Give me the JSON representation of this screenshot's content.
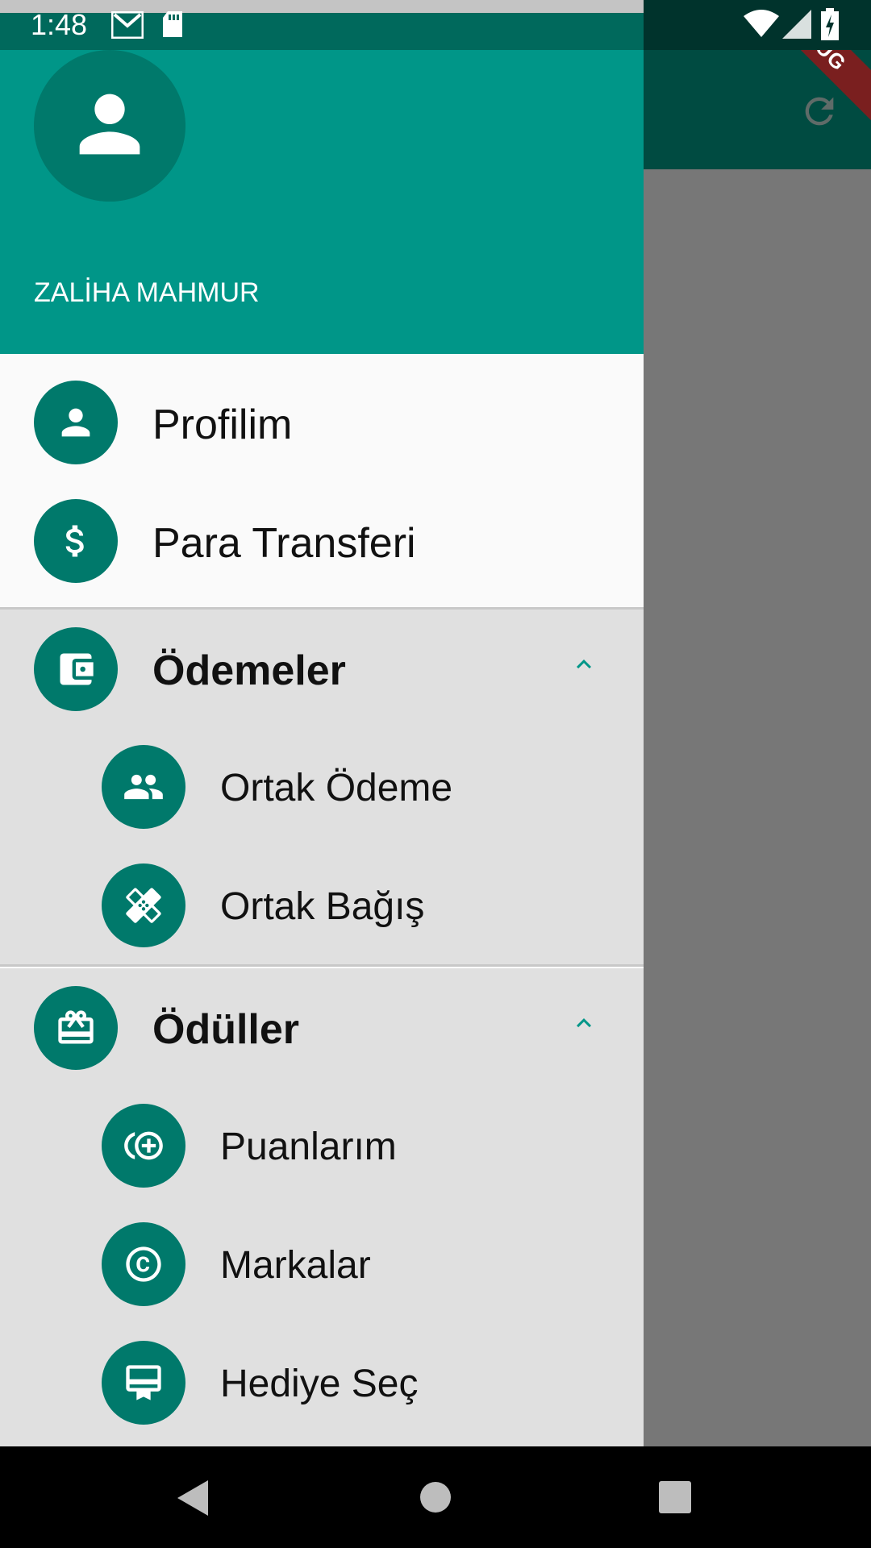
{
  "status_bar": {
    "time": "1:48"
  },
  "debug_banner": "DEBUG",
  "drawer": {
    "user_name": "ZALİHA MAHMUR",
    "items": [
      {
        "label": "Profilim",
        "icon": "person-icon"
      },
      {
        "label": "Para Transferi",
        "icon": "dollar-icon"
      }
    ],
    "sections": [
      {
        "title": "Ödemeler",
        "icon": "wallet-icon",
        "expanded": true,
        "children": [
          {
            "label": "Ortak Ödeme",
            "icon": "people-icon"
          },
          {
            "label": "Ortak Bağış",
            "icon": "bandage-icon"
          }
        ]
      },
      {
        "title": "Ödüller",
        "icon": "gift-card-icon",
        "expanded": true,
        "children": [
          {
            "label": "Puanlarım",
            "icon": "add-points-icon"
          },
          {
            "label": "Markalar",
            "icon": "copyright-icon"
          },
          {
            "label": "Hediye Seç",
            "icon": "card-membership-icon"
          }
        ]
      }
    ]
  },
  "colors": {
    "accent": "#009688",
    "accent_dark": "#00796b",
    "section_bg": "#e0e0e0",
    "drawer_bg": "#fafafa"
  }
}
